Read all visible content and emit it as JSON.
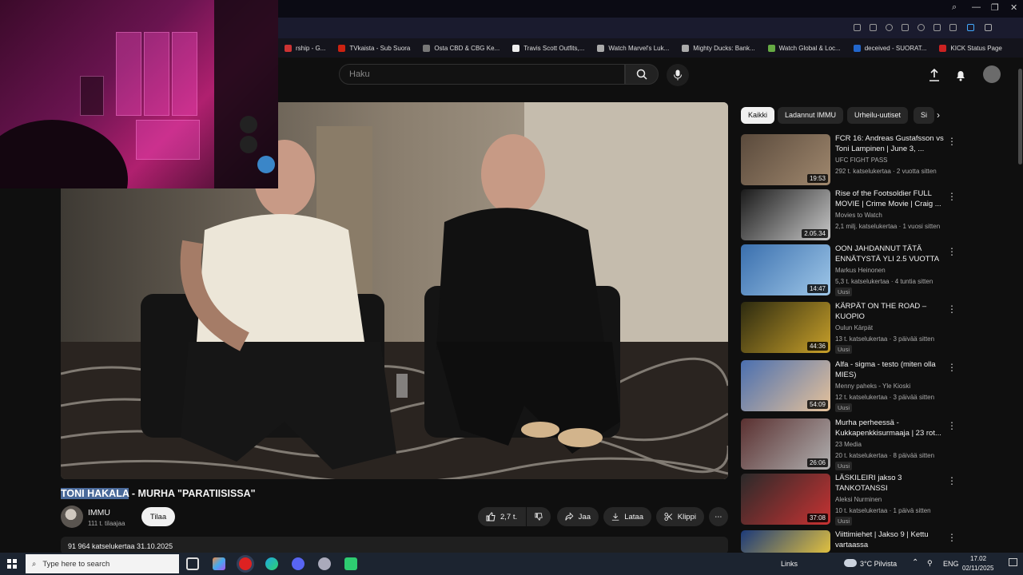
{
  "browser": {
    "bookmarks": [
      {
        "label": "rship - G...",
        "color": "#c33"
      },
      {
        "label": "TVkaista - Sub Suora",
        "color": "#c21"
      },
      {
        "label": "Osta CBD & CBG Ke...",
        "color": "#777"
      },
      {
        "label": "Travis Scott Outfits,...",
        "color": "#eee"
      },
      {
        "label": "Watch Marvel's Luk...",
        "color": "#aaa"
      },
      {
        "label": "Mighty Ducks: Bank...",
        "color": "#aaa"
      },
      {
        "label": "Watch Global & Loc...",
        "color": "#6a4"
      },
      {
        "label": "deceived - SUORAT...",
        "color": "#26c"
      },
      {
        "label": "KICK Status Page",
        "color": "#c22"
      }
    ]
  },
  "header": {
    "search_placeholder": "Haku"
  },
  "video": {
    "title_highlight": "TONI HAKALA",
    "title_rest": " - MURHA \"PARATIISISSA\"",
    "channel_name": "IMMU",
    "channel_subs": "111 t. tilaajaa",
    "subscribe_label": "Tilaa",
    "likes": "2,7 t.",
    "share_label": "Jaa",
    "download_label": "Lataa",
    "clip_label": "Klippi",
    "views_date": "91 964 katselukertaa  31.10.2025"
  },
  "chips": [
    {
      "label": "Kaikki",
      "active": true
    },
    {
      "label": "Ladannut IMMU",
      "active": false
    },
    {
      "label": "Urheilu-uutiset",
      "active": false
    },
    {
      "label": "Si",
      "active": false
    }
  ],
  "recommendations": [
    {
      "title": "FCR 16: Andreas Gustafsson vs Toni Lampinen | June 3, ...",
      "channel": "UFC FIGHT PASS",
      "meta": "292 t. katselukertaa · 2 vuotta sitten",
      "duration": "19:53",
      "badge": ""
    },
    {
      "title": "Rise of the Footsoldier FULL MOVIE | Crime Movie | Craig ...",
      "channel": "Movies to Watch",
      "meta": "2,1 milj. katselukertaa · 1 vuosi sitten",
      "duration": "2.05.34",
      "badge": ""
    },
    {
      "title": "OON JAHDANNUT TÄTÄ ENNÄTYSTÄ YLI 2.5 VUOTTA",
      "channel": "Markus Heinonen",
      "meta": "5,3 t. katselukertaa · 4 tuntia sitten",
      "duration": "14:47",
      "badge": "Uusi"
    },
    {
      "title": "KÄRPÄT ON THE ROAD – KUOPIO",
      "channel": "Oulun Kärpät",
      "meta": "13 t. katselukertaa · 3 päivää sitten",
      "duration": "44:36",
      "badge": "Uusi"
    },
    {
      "title": "Alfa - sigma - testo (miten olla MIES)",
      "channel": "Menny paheks - Yle Kioski",
      "meta": "12 t. katselukertaa · 3 päivää sitten",
      "duration": "54:09",
      "badge": "Uusi"
    },
    {
      "title": "Murha perheessä - Kukkapenkkisurmaaja | 23 rot...",
      "channel": "23 Media",
      "meta": "20 t. katselukertaa · 8 päivää sitten",
      "duration": "26:06",
      "badge": "Uusi"
    },
    {
      "title": "LÄSKILEIRI jakso 3 TANKOTANSSI",
      "channel": "Aleksi Nurminen",
      "meta": "10 t. katselukertaa · 1 päivä sitten",
      "duration": "37:08",
      "badge": "Uusi"
    },
    {
      "title": "Viittimiehet | Jakso 9 | Kettu vartaassa",
      "channel": "",
      "meta": "",
      "duration": "",
      "badge": ""
    }
  ],
  "taskbar": {
    "search_placeholder": "Type here to search",
    "links_label": "Links",
    "weather": "3°C Pilvista",
    "lang": "ENG",
    "time": "17.02",
    "date": "02/11/2025"
  }
}
